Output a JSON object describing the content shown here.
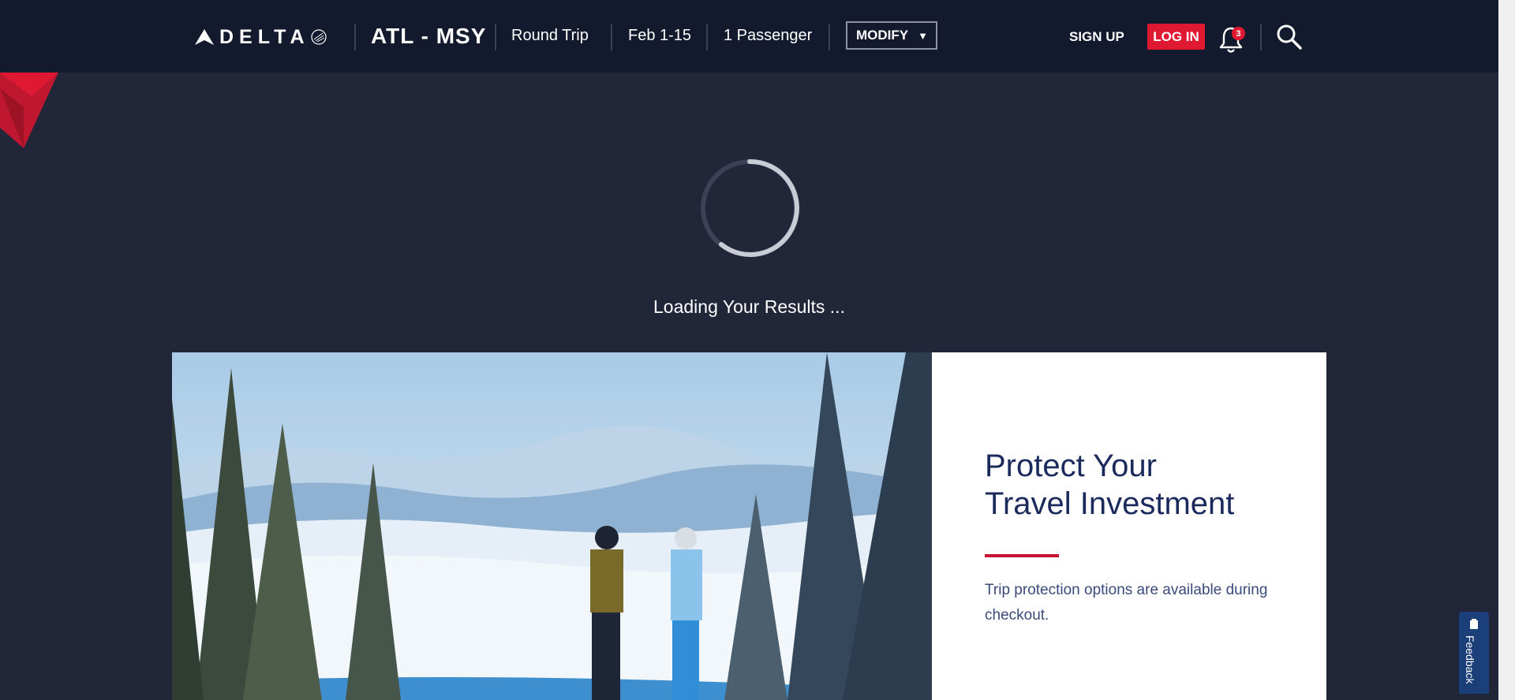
{
  "header": {
    "logo_text": "DELTA",
    "route": "ATL - MSY",
    "trip_type": "Round Trip",
    "dates": "Feb 1-15",
    "passengers": "1 Passenger",
    "modify_label": "MODIFY",
    "signup_label": "SIGN UP",
    "login_label": "LOG IN",
    "notification_count": "3"
  },
  "loading": {
    "text": "Loading Your Results ..."
  },
  "promo": {
    "title_line1": "Protect Your",
    "title_line2": "Travel Investment",
    "body": "Trip protection options are available during checkout."
  },
  "feedback": {
    "label": "Feedback"
  },
  "colors": {
    "nav_bg": "#131a2d",
    "page_bg": "#212639",
    "brand_red": "#e01933",
    "title_navy": "#1b2a5c"
  }
}
